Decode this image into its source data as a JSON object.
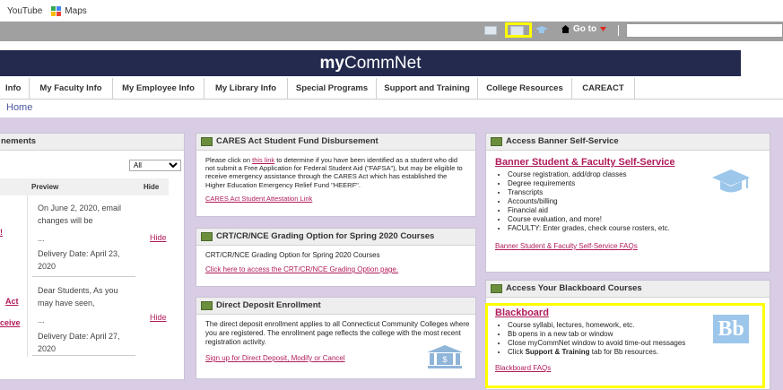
{
  "bookmarks": [
    {
      "label": "YouTube"
    },
    {
      "label": "Maps"
    }
  ],
  "topbar": {
    "goto_label": "Go to",
    "search_value": ""
  },
  "header": {
    "brand_prefix": "my",
    "brand_name": "CommNet"
  },
  "nav": {
    "items": [
      "Info",
      "My Faculty Info",
      "My Employee Info",
      "My Library Info",
      "Special Programs",
      "Support and Training",
      "College Resources",
      "CAREACT"
    ]
  },
  "breadcrumb": "Home",
  "announcements": {
    "title": "nements",
    "filter_value": "All",
    "col_preview": "Preview",
    "col_hide": "Hide",
    "rows": [
      {
        "title_fragment": "!",
        "preview_line1": "On June 2, 2020, email",
        "preview_line2": "changes will be",
        "ellipsis": "...",
        "delivery_line1": "Delivery Date: April 23,",
        "delivery_line2": "2020",
        "hide": "Hide"
      },
      {
        "title_fragment": "Act",
        "title_fragment2": "ceive",
        "preview_line1": "Dear Students, As you",
        "preview_line2": "may have seen,",
        "ellipsis": "...",
        "delivery_line1": "Delivery Date: April 27,",
        "delivery_line2": "2020",
        "hide": "Hide"
      }
    ]
  },
  "cares": {
    "title": "CARES Act Student Fund Disbursement",
    "text_pre": "Please click on ",
    "text_link": "this link",
    "text_post": " to determine if you have been identified as a student who did not submit a Free Application for Federal Student Aid (\"FAFSA\"), but may be eligible to receive emergency assistance through the CARES Act which has established the Higher Education Emergency Relief Fund \"HEERF\".",
    "link": "CARES Act Student Attestation Link"
  },
  "grading": {
    "title": "CRT/CR/NCE Grading Option for Spring 2020 Courses",
    "text": "CRT/CR/NCE Grading Option for Spring 2020 Courses",
    "link": "Click here to access the CRT/CR/NCE Grading Option page."
  },
  "deposit": {
    "title": "Direct Deposit Enrollment",
    "text": "The direct deposit enrollment applies to all Connecticut Community Colleges where you are registered. The enrollment page reflects the college with the most recent registration activity.",
    "link": "Sign up for Direct Deposit, Modify or Cancel"
  },
  "banner": {
    "title": "Access Banner Self-Service",
    "heading": "Banner Student & Faculty Self-Service",
    "items": [
      "Course registration, add/drop classes",
      "Degree requirements",
      "Transcripts",
      "Accounts/billing",
      "Financial aid",
      "Course evaluation, and more!",
      "FACULTY:  Enter grades, check course rosters, etc."
    ],
    "faq": "Banner Student & Faculty Self-Service FAQs"
  },
  "blackboard": {
    "title": "Access Your Blackboard Courses",
    "heading": "Blackboard",
    "items": [
      "Course syllabi, lectures, homework, etc.",
      "Bb opens in a new tab or window",
      "Close myCommNet window to avoid time-out messages"
    ],
    "item4_pre": "Click ",
    "item4_bold": "Support & Training",
    "item4_post": " tab for Bb resources.",
    "faq": "Blackboard FAQs",
    "logo": "Bb"
  },
  "colors": {
    "header": "#232a4e",
    "content_bg": "#d8cde4",
    "link": "#b01b5b",
    "highlight": "#ffff00"
  }
}
